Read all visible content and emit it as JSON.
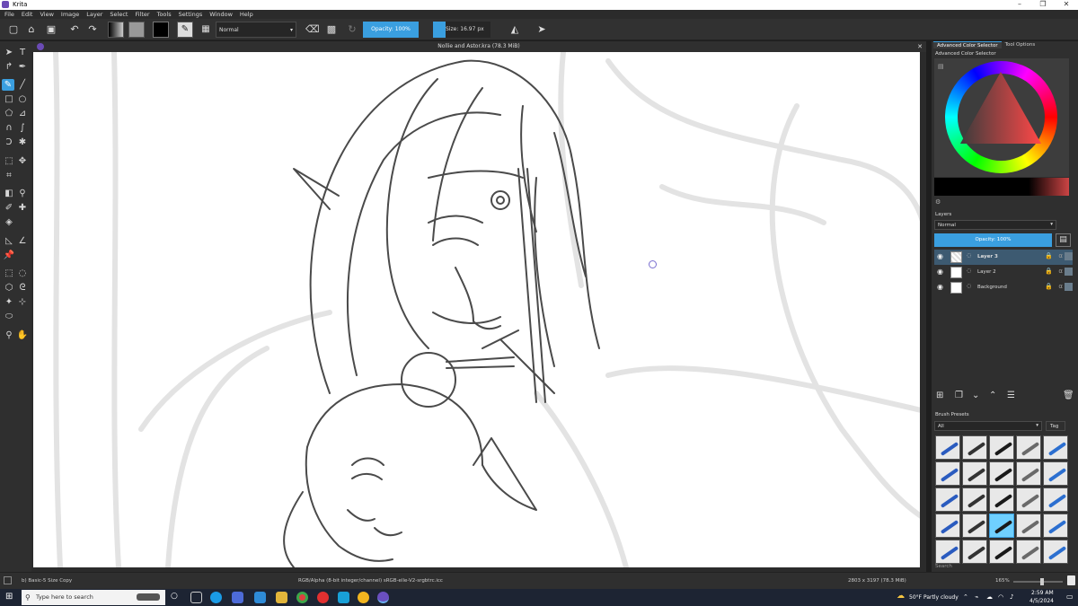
{
  "window": {
    "title": "Krita",
    "controls": [
      "–",
      "❐",
      "✕"
    ]
  },
  "menu": [
    "File",
    "Edit",
    "View",
    "Image",
    "Layer",
    "Select",
    "Filter",
    "Tools",
    "Settings",
    "Window",
    "Help"
  ],
  "toolbar": {
    "blend_mode": "Normal",
    "opacity_label": "Opacity: 100%",
    "size_label": "Size: 16.97 px"
  },
  "document": {
    "title": "Nollie and Astor.kra (78.3 MiB)"
  },
  "docker": {
    "tabs": [
      "Advanced Color Selector",
      "Tool Options"
    ],
    "color_selector_title": "Advanced Color Selector",
    "layers_title": "Layers",
    "layers_blend": "Normal",
    "layers_opacity": "Opacity: 100%",
    "layers": [
      {
        "name": "Layer 3",
        "selected": true
      },
      {
        "name": "Layer 2",
        "selected": false
      },
      {
        "name": "Background",
        "selected": false
      }
    ],
    "presets_title": "Brush Presets",
    "presets_filter": "All",
    "presets_tag": "Tag",
    "presets_search": "Search"
  },
  "status": {
    "brush": "b) Basic-5 Size Copy",
    "color_space": "RGB/Alpha (8-bit integer/channel)  sRGB-elle-V2-srgbtrc.icc",
    "dimensions": "2803 x 3197 (78.3 MiB)",
    "zoom": "165%"
  },
  "taskbar": {
    "search_placeholder": "Type here to search",
    "weather": "50°F  Partly cloudy",
    "time": "2:59 AM",
    "date": "4/5/2024"
  },
  "colors": {
    "accent": "#3a9fe0",
    "panel": "#2f2f2f",
    "background": "#1e1e1e"
  }
}
